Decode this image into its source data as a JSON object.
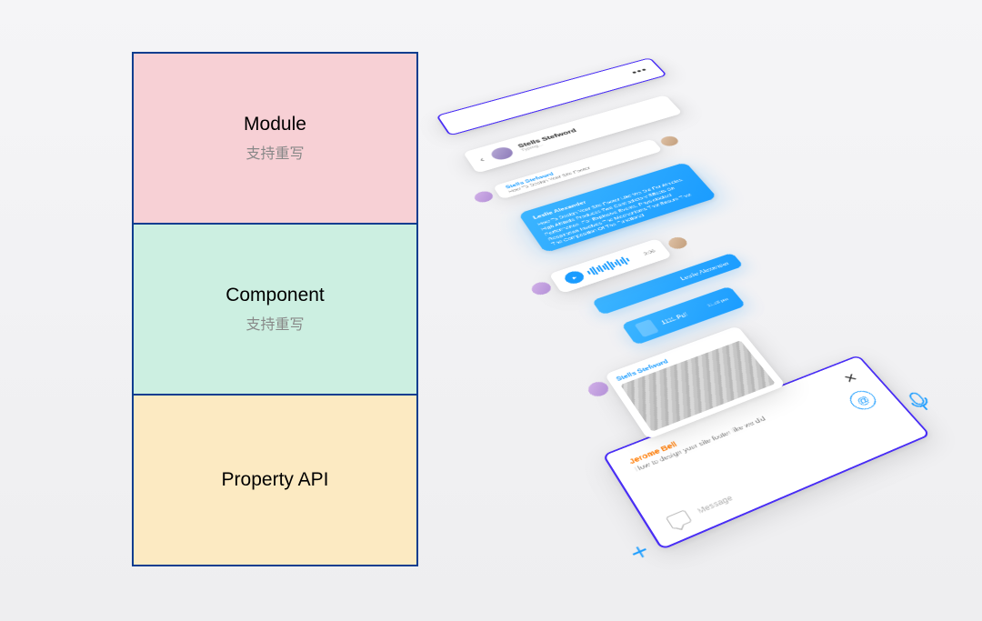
{
  "diagram": {
    "layers": [
      {
        "title": "Module",
        "subtitle": "支持重写"
      },
      {
        "title": "Component",
        "subtitle": "支持重写"
      },
      {
        "title": "Property API",
        "subtitle": ""
      }
    ]
  },
  "chat": {
    "header_name": "Stells Stefword",
    "header_status": "Typing...",
    "dots": "•••",
    "msg1_sender": "Stells Stefword",
    "msg1_text": "How To Design Your Site Footer",
    "msg2_sender": "Leslie Alexander",
    "msg2_text": "How To Design Your Site Footer Like We Did For Athletes. High Altitude Produces Two Contradictory Effects On Performance. For Explosive Events. Physiological Respiration Involves The Mechanisms That Ensure That The Composition Of The Functional",
    "audio_time": "0:06",
    "msg3_sender": "Leslie Alexander",
    "file_name": "1111.Pdf",
    "file_time": "11:58 pm",
    "msg4_sender": "Stells Stefword",
    "compose_from": "Jerome Bell",
    "compose_text": "How to design your site footer like we did",
    "close": "✕",
    "attach": "@",
    "input_placeholder": "Message",
    "plus": "+"
  }
}
